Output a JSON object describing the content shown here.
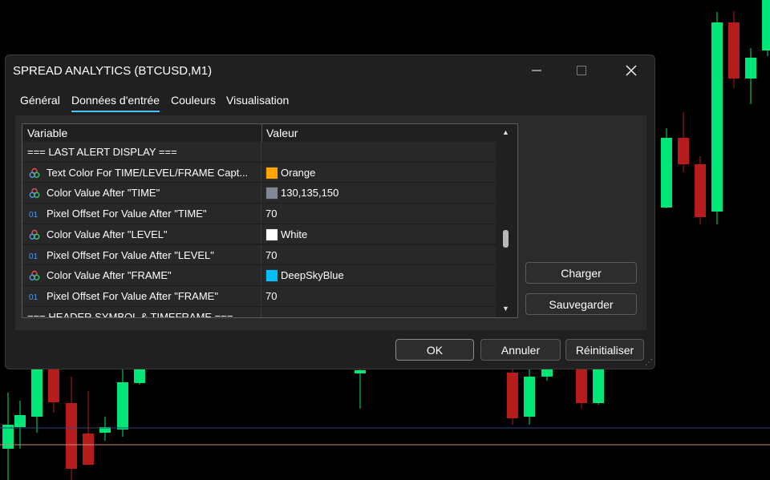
{
  "window": {
    "title": "SPREAD ANALYTICS (BTCUSD,M1)",
    "minimize_icon": "minimize-icon",
    "maximize_icon": "maximize-icon",
    "close_icon": "close-icon"
  },
  "tabs": [
    {
      "label": "Général",
      "active": false
    },
    {
      "label": "Données d'entrée",
      "active": true
    },
    {
      "label": "Couleurs",
      "active": false
    },
    {
      "label": "Visualisation",
      "active": false
    }
  ],
  "grid": {
    "headers": {
      "variable": "Variable",
      "value": "Valeur"
    },
    "rows": [
      {
        "type": "section",
        "label": "=== LAST ALERT DISPLAY ===",
        "value": ""
      },
      {
        "type": "color",
        "label": "Text Color For TIME/LEVEL/FRAME Capt...",
        "value": "Orange",
        "swatch": "#ffa500"
      },
      {
        "type": "color",
        "label": "Color Value After \"TIME\"",
        "value": "130,135,150",
        "swatch": "#828796"
      },
      {
        "type": "int",
        "label": "Pixel Offset For Value After \"TIME\"",
        "value": "70"
      },
      {
        "type": "color",
        "label": "Color Value After \"LEVEL\"",
        "value": "White",
        "swatch": "#ffffff"
      },
      {
        "type": "int",
        "label": "Pixel Offset For Value After \"LEVEL\"",
        "value": "70"
      },
      {
        "type": "color",
        "label": "Color Value After \"FRAME\"",
        "value": "DeepSkyBlue",
        "swatch": "#00bfff"
      },
      {
        "type": "int",
        "label": "Pixel Offset For Value After \"FRAME\"",
        "value": "70"
      },
      {
        "type": "section",
        "label": "=== HEADER SYMBOL & TIMEFRAME ===",
        "value": ""
      }
    ]
  },
  "side_buttons": {
    "load": "Charger",
    "save": "Sauvegarder"
  },
  "footer": {
    "ok": "OK",
    "cancel": "Annuler",
    "reset": "Réinitialiser"
  },
  "colors": {
    "accent": "#4cc2ff",
    "bull": "#00e676",
    "bear": "#b71c1c",
    "dialog_bg": "#202020"
  }
}
